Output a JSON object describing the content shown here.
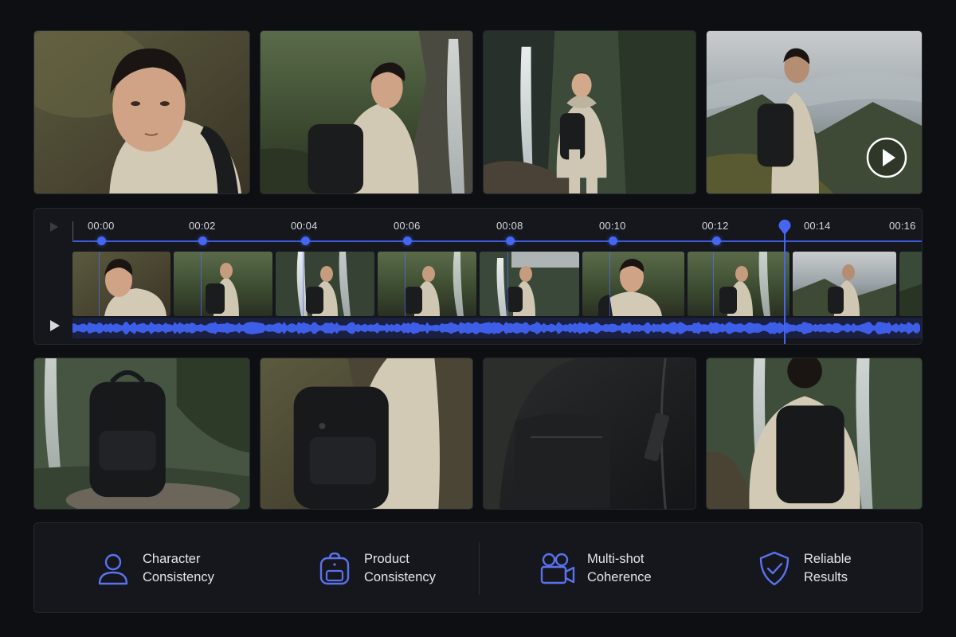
{
  "timeline": {
    "ticks": [
      "00:00",
      "00:02",
      "00:04",
      "00:06",
      "00:08",
      "00:10",
      "00:12",
      "00:14",
      "00:16"
    ]
  },
  "features": [
    {
      "line1": "Character",
      "line2": "Consistency",
      "icon": "user-icon"
    },
    {
      "line1": "Product",
      "line2": "Consistency",
      "icon": "backpack-icon"
    },
    {
      "line1": "Multi-shot",
      "line2": "Coherence",
      "icon": "video-camera-icon"
    },
    {
      "line1": "Reliable",
      "line2": "Results",
      "icon": "shield-check-icon"
    }
  ],
  "colors": {
    "accent": "#4566f2",
    "background": "#0e0f12",
    "panel": "#15171c"
  }
}
